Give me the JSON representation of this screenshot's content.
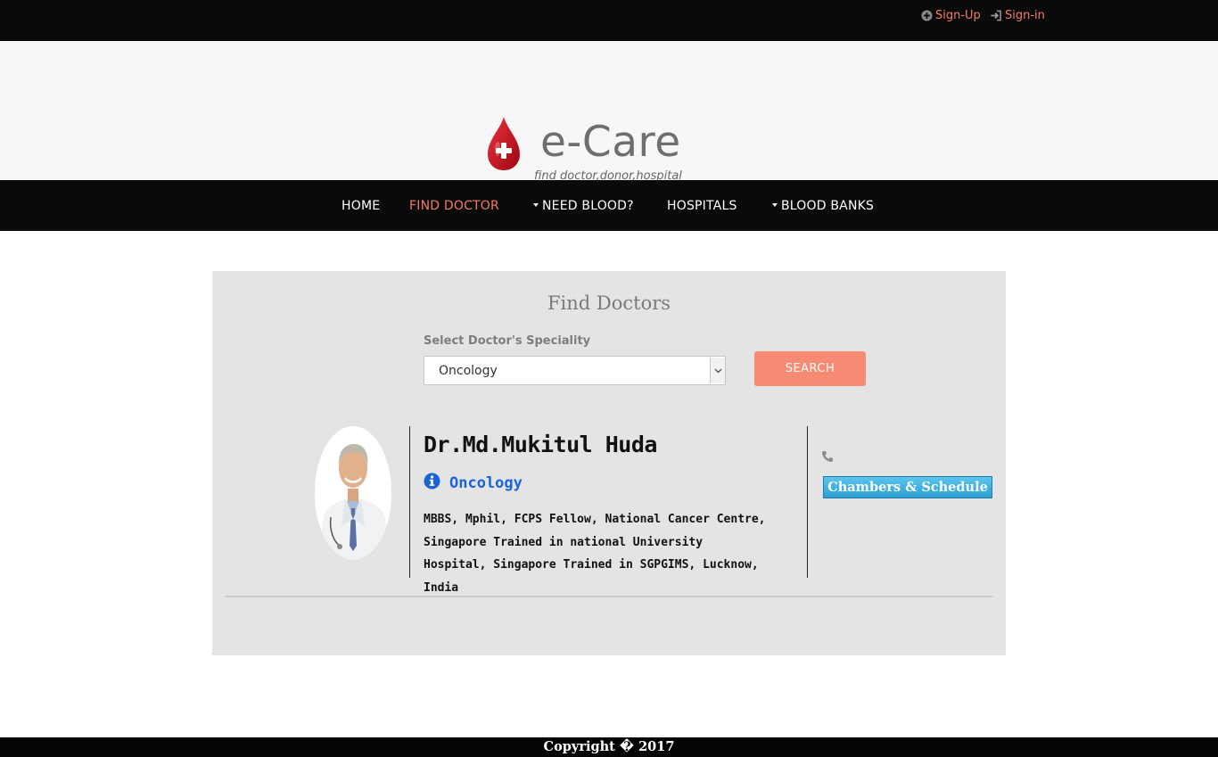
{
  "header": {
    "signup_label": "Sign-Up",
    "signin_label": "Sign-in",
    "signup_icon": "plus-circle-icon",
    "signin_icon": "sign-in-icon"
  },
  "brand": {
    "title": "e-Care",
    "tagline": "find doctor,donor,hospital",
    "logo_icon": "blood-drop-cross-icon",
    "logo_color": "#c8101e"
  },
  "nav": {
    "items": [
      {
        "label": "HOME"
      },
      {
        "label": "FIND DOCTOR",
        "active": true
      },
      {
        "label": "NEED BLOOD?",
        "dropdown": true
      },
      {
        "label": "HOSPITALS"
      },
      {
        "label": "BLOOD BANKS",
        "dropdown": true
      }
    ]
  },
  "search": {
    "title": "Find Doctors",
    "speciality_label": "Select Doctor's Speciality",
    "selected_speciality": "Oncology",
    "button_label": "SEARCH"
  },
  "results": [
    {
      "name": "Dr.Md.Mukitul Huda",
      "speciality": "Oncology",
      "qualifications": "MBBS, Mphil, FCPS Fellow, National Cancer Centre, Singapore Trained in national University Hospital, Singapore Trained in SGPGIMS, Lucknow, India",
      "phone_icon": "phone-icon",
      "info_icon": "info-circle-icon",
      "chambers_label": "Chambers & Schedule"
    }
  ],
  "footer": {
    "copyright": "Copyright � 2017"
  },
  "colors": {
    "accent": "#f47c64",
    "search_button": "#f78a72",
    "speciality_text": "#1a64d4",
    "chambers_button": "#2a9fd1",
    "dark_bar": "#0a0a0a",
    "panel_bg": "#e4e4e4"
  }
}
